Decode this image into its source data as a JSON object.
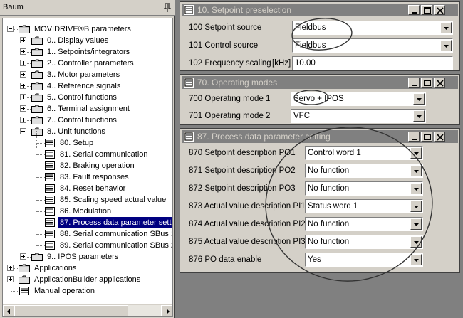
{
  "tree_panel": {
    "title": "Baum",
    "items": [
      {
        "label": "MOVIDRIVE®B parameters",
        "level": 0,
        "expander": "minus",
        "icon": "folder"
      },
      {
        "label": "0.. Display values",
        "level": 1,
        "expander": "plus",
        "icon": "folder"
      },
      {
        "label": "1.. Setpoints/integrators",
        "level": 1,
        "expander": "plus",
        "icon": "folder"
      },
      {
        "label": "2.. Controller parameters",
        "level": 1,
        "expander": "plus",
        "icon": "folder"
      },
      {
        "label": "3.. Motor parameters",
        "level": 1,
        "expander": "plus",
        "icon": "folder"
      },
      {
        "label": "4.. Reference signals",
        "level": 1,
        "expander": "plus",
        "icon": "folder"
      },
      {
        "label": "5.. Control functions",
        "level": 1,
        "expander": "plus",
        "icon": "folder"
      },
      {
        "label": "6.. Terminal assignment",
        "level": 1,
        "expander": "plus",
        "icon": "folder"
      },
      {
        "label": "7.. Control functions",
        "level": 1,
        "expander": "plus",
        "icon": "folder"
      },
      {
        "label": "8.. Unit functions",
        "level": 1,
        "expander": "minus",
        "icon": "folder"
      },
      {
        "label": "80. Setup",
        "level": 2,
        "expander": "none",
        "icon": "document"
      },
      {
        "label": "81. Serial communication",
        "level": 2,
        "expander": "none",
        "icon": "document"
      },
      {
        "label": "82. Braking operation",
        "level": 2,
        "expander": "none",
        "icon": "document"
      },
      {
        "label": "83. Fault responses",
        "level": 2,
        "expander": "none",
        "icon": "document"
      },
      {
        "label": "84. Reset behavior",
        "level": 2,
        "expander": "none",
        "icon": "document"
      },
      {
        "label": "85. Scaling speed actual value",
        "level": 2,
        "expander": "none",
        "icon": "document"
      },
      {
        "label": "86. Modulation",
        "level": 2,
        "expander": "none",
        "icon": "document"
      },
      {
        "label": "87. Process data parameter settin",
        "level": 2,
        "expander": "none",
        "icon": "document",
        "selected": true
      },
      {
        "label": "88. Serial communication SBus 1",
        "level": 2,
        "expander": "none",
        "icon": "document"
      },
      {
        "label": "89. Serial communication SBus 2",
        "level": 2,
        "expander": "none",
        "icon": "document"
      },
      {
        "label": "9.. IPOS parameters",
        "level": 1,
        "expander": "plus",
        "icon": "folder"
      },
      {
        "label": "Applications",
        "level": 0,
        "expander": "plus",
        "icon": "folder"
      },
      {
        "label": "ApplicationBuilder applications",
        "level": 0,
        "expander": "plus",
        "icon": "folder"
      },
      {
        "label": "Manual operation",
        "level": 0,
        "expander": "none",
        "icon": "document"
      }
    ]
  },
  "windows": [
    {
      "id": "setpoint",
      "title": "10. Setpoint preselection",
      "rows": [
        {
          "label": "100 Setpoint source",
          "kind": "combo",
          "value": "Fieldbus"
        },
        {
          "label": "101 Control source",
          "kind": "combo",
          "value": "Fieldbus"
        },
        {
          "label": "102 Frequency scaling",
          "kind": "field",
          "unit": "[kHz]",
          "value": "10.00"
        }
      ]
    },
    {
      "id": "opmodes",
      "title": "70. Operating modes",
      "rows": [
        {
          "label": "700 Operating mode 1",
          "kind": "combo",
          "value": "Servo + IPOS"
        },
        {
          "label": "701 Operating mode 2",
          "kind": "combo",
          "value": "VFC"
        }
      ]
    },
    {
      "id": "processdata",
      "title": "87. Process data parameter setting",
      "rows": [
        {
          "label": "870 Setpoint description PO1",
          "kind": "combo",
          "value": "Control word 1"
        },
        {
          "label": "871 Setpoint description PO2",
          "kind": "combo",
          "value": "No function"
        },
        {
          "label": "872 Setpoint description PO3",
          "kind": "combo",
          "value": "No function"
        },
        {
          "label": "873 Actual value description PI1",
          "kind": "combo",
          "value": "Status word 1"
        },
        {
          "label": "874 Actual value description PI2",
          "kind": "combo",
          "value": "No function"
        },
        {
          "label": "875 Actual value description PI3",
          "kind": "combo",
          "value": "No function"
        },
        {
          "label": "876 PO data enable",
          "kind": "combo",
          "value": "Yes"
        }
      ]
    }
  ],
  "icons": {
    "tree_pin": "pin-icon",
    "window_icon": "parameter-window-icon",
    "minimize": "minimize-icon",
    "maximize": "maximize-icon",
    "close": "close-icon",
    "dropdown": "chevron-down-icon"
  },
  "colors": {
    "face": "#d4d0c8",
    "workspace": "#808080",
    "selection": "#000080",
    "inactive_title": "#808080"
  }
}
